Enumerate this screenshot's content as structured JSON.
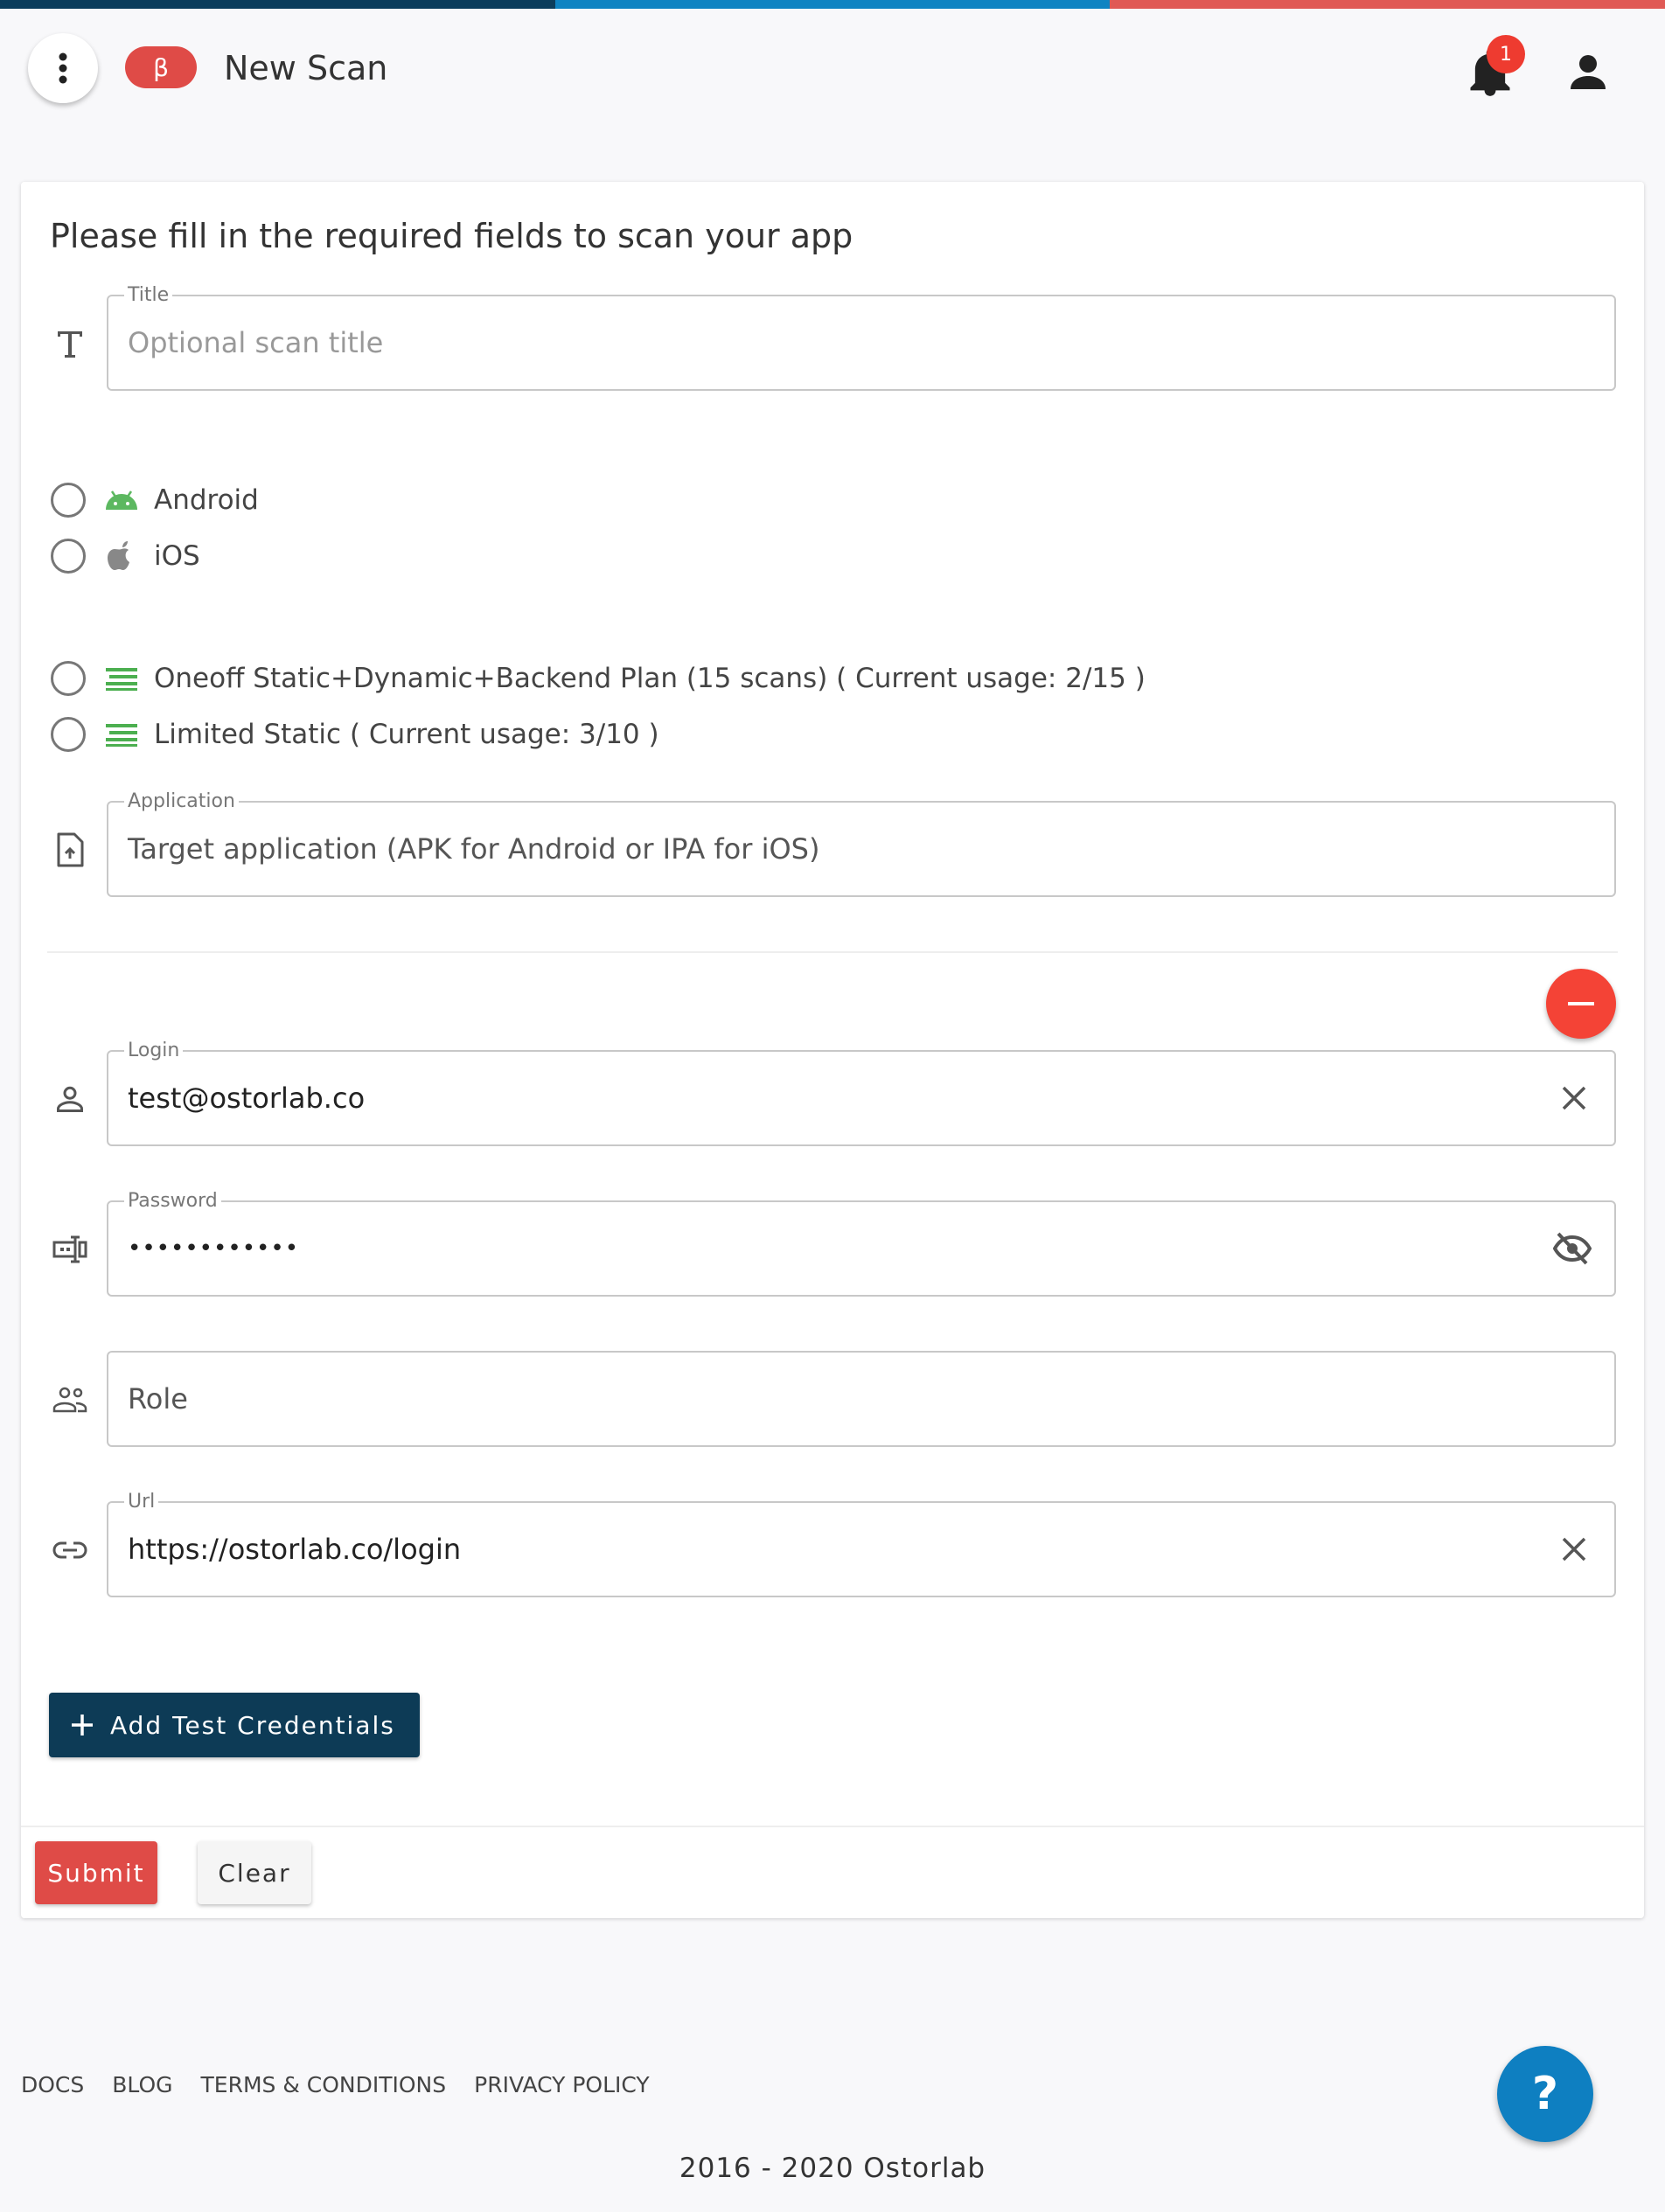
{
  "colors": {
    "bar_navy": "#0c3e5c",
    "bar_blue": "#0f84c2",
    "bar_red": "#e05a55",
    "accent_red": "#df4b47",
    "badge_red": "#ee3b30",
    "remove_red": "#f44336",
    "navy_button": "#0d3b56",
    "help_blue": "#0e7fc1",
    "plan_green": "#4caf50",
    "android_green": "#5cb860",
    "ios_gray": "#888888"
  },
  "header": {
    "beta_label": "β",
    "title": "New Scan",
    "notification_count": "1",
    "icons": {
      "menu": "more-vert-icon",
      "notifications": "bell-icon",
      "account": "account-icon"
    }
  },
  "form": {
    "heading": "Please fill in the required fields to scan your app",
    "title_field": {
      "legend": "Title",
      "placeholder": "Optional scan title",
      "icon": "text-icon"
    },
    "platforms": [
      {
        "label": "Android",
        "icon": "android-icon",
        "selected": false
      },
      {
        "label": "iOS",
        "icon": "apple-icon",
        "selected": false
      }
    ],
    "plans": [
      {
        "label": "Oneoff Static+Dynamic+Backend Plan (15 scans) ( Current usage: 2/15 )",
        "icon": "plan-icon",
        "selected": false
      },
      {
        "label": "Limited Static ( Current usage: 3/10 )",
        "icon": "plan-icon",
        "selected": false
      }
    ],
    "application_field": {
      "legend": "Application",
      "value": "Target application (APK for Android or IPA for iOS)",
      "icon": "upload-file-icon"
    },
    "credentials": {
      "login": {
        "legend": "Login",
        "value": "test@ostorlab.co",
        "icon": "person-icon",
        "trailing_icon": "clear-icon"
      },
      "password": {
        "legend": "Password",
        "value": "••••••••••••",
        "icon": "password-icon",
        "trailing_icon": "visibility-off-icon"
      },
      "role": {
        "placeholder": "Role",
        "icon": "people-icon"
      },
      "url": {
        "legend": "Url",
        "value": "https://ostorlab.co/login",
        "icon": "link-icon",
        "trailing_icon": "clear-icon"
      }
    },
    "add_credentials_label": "Add Test Credentials",
    "submit_label": "Submit",
    "clear_label": "Clear"
  },
  "footer": {
    "links": [
      "DOCS",
      "BLOG",
      "TERMS & CONDITIONS",
      "PRIVACY POLICY"
    ],
    "help_label": "?",
    "copyright": "2016 - 2020 Ostorlab"
  }
}
